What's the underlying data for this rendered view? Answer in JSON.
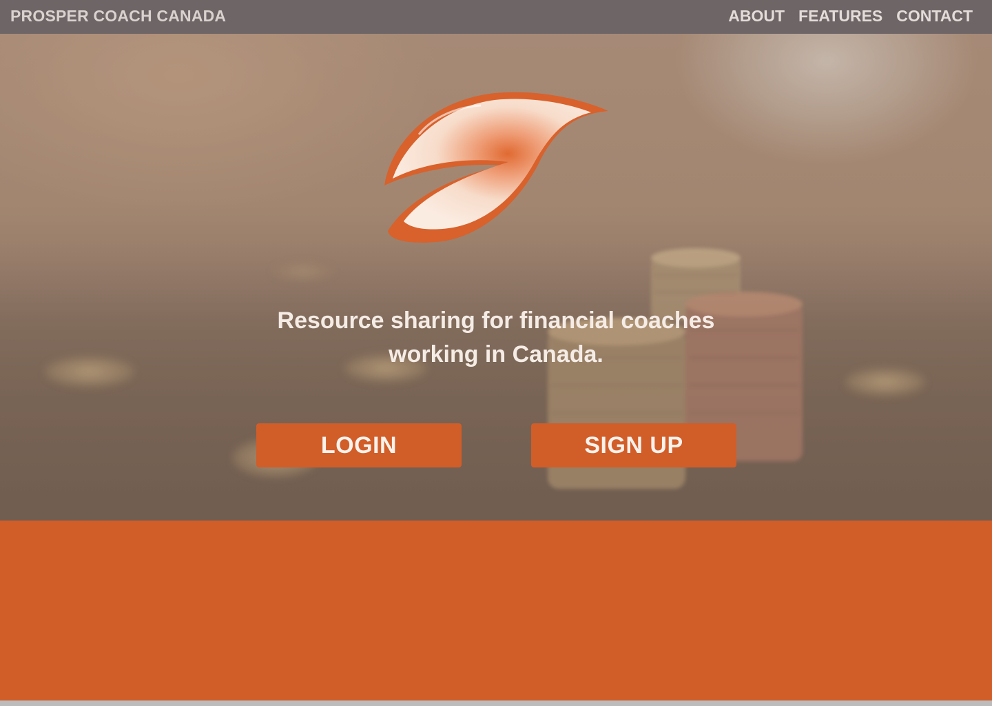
{
  "header": {
    "brand": "PROSPER COACH CANADA",
    "nav": [
      {
        "label": "ABOUT"
      },
      {
        "label": "FEATURES"
      },
      {
        "label": "CONTACT"
      }
    ]
  },
  "hero": {
    "logo_icon": "leaf-logo-icon",
    "tagline_line1": "Resource sharing for financial coaches",
    "tagline_line2": "working in Canada.",
    "login_label": "LOGIN",
    "signup_label": "SIGN UP"
  },
  "colors": {
    "accent": "#d15d29",
    "topbar": "#6e6567",
    "text_light": "#f5ece6"
  }
}
